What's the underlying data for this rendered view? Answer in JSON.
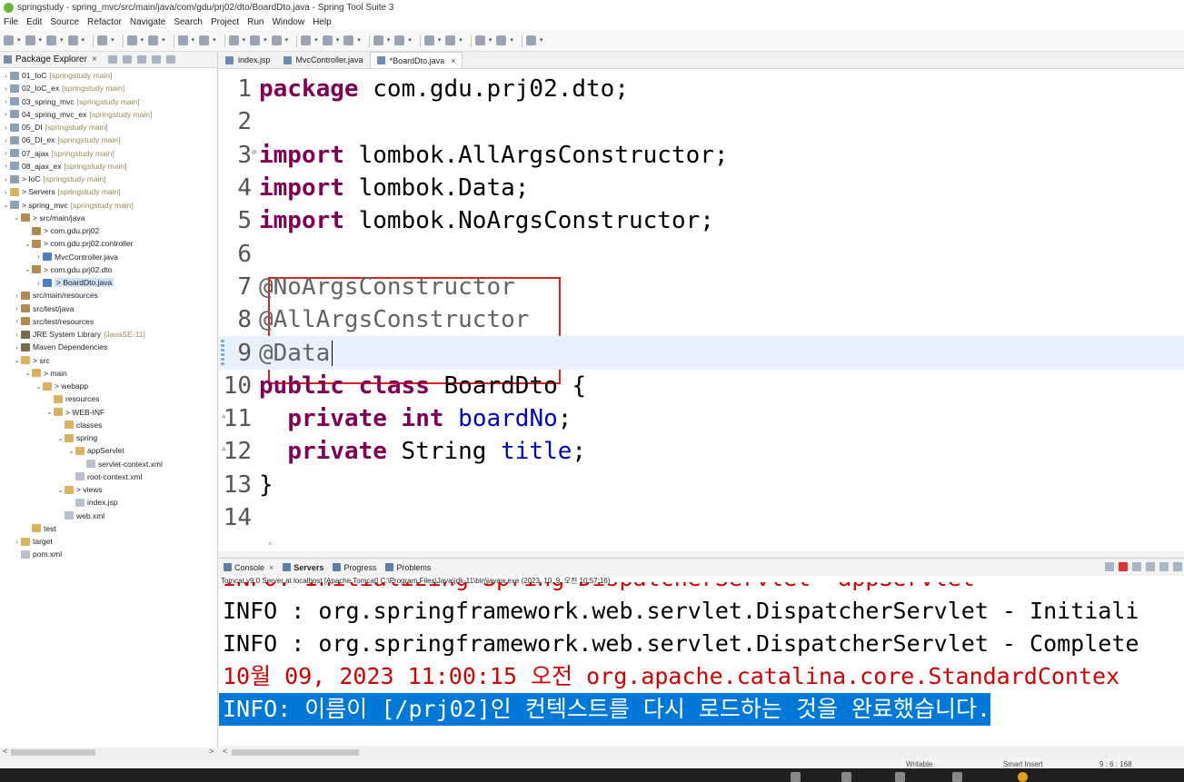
{
  "window": {
    "title": "springstudy - spring_mvc/src/main/java/com/gdu/prj02/dto/BoardDto.java - Spring Tool Suite 3"
  },
  "menu": [
    "File",
    "Edit",
    "Source",
    "Refactor",
    "Navigate",
    "Search",
    "Project",
    "Run",
    "Window",
    "Help"
  ],
  "explorer": {
    "title": "Package Explorer",
    "tree": [
      {
        "label": "01_IoC",
        "deco": "[springstudy main]",
        "twisty": ">",
        "icon": "project",
        "depth": 0
      },
      {
        "label": "02_IoC_ex",
        "deco": "[springstudy main]",
        "twisty": ">",
        "icon": "project",
        "depth": 0
      },
      {
        "label": "03_spring_mvc",
        "deco": "[springstudy main]",
        "twisty": ">",
        "icon": "project",
        "depth": 0
      },
      {
        "label": "04_spring_mvc_ex",
        "deco": "[springstudy main]",
        "twisty": ">",
        "icon": "project",
        "depth": 0
      },
      {
        "label": "05_DI",
        "deco": "[springstudy main]",
        "twisty": ">",
        "icon": "project",
        "depth": 0
      },
      {
        "label": "06_DI_ex",
        "deco": "[springstudy main]",
        "twisty": ">",
        "icon": "project",
        "depth": 0
      },
      {
        "label": "07_ajax",
        "deco": "[springstudy main]",
        "twisty": ">",
        "icon": "project",
        "depth": 0
      },
      {
        "label": "08_ajax_ex",
        "deco": "[springstudy main]",
        "twisty": ">",
        "icon": "project",
        "depth": 0
      },
      {
        "label": "> IoC",
        "deco": "[springstudy main]",
        "twisty": ">",
        "icon": "project",
        "depth": 0
      },
      {
        "label": "> Servers",
        "deco": "[springstudy main]",
        "twisty": ">",
        "icon": "folder",
        "depth": 0
      },
      {
        "label": "> spring_mvc",
        "deco": "[springstudy main]",
        "twisty": "v",
        "icon": "project",
        "depth": 0
      },
      {
        "label": "> src/main/java",
        "deco": "",
        "twisty": "v",
        "icon": "package",
        "depth": 1
      },
      {
        "label": "> com.gdu.prj02",
        "deco": "",
        "twisty": "",
        "icon": "package",
        "depth": 2
      },
      {
        "label": "> com.gdu.prj02.controller",
        "deco": "",
        "twisty": "v",
        "icon": "package",
        "depth": 2
      },
      {
        "label": "MvcController.java",
        "deco": "",
        "twisty": ">",
        "icon": "java",
        "depth": 3
      },
      {
        "label": "> com.gdu.prj02.dto",
        "deco": "",
        "twisty": "v",
        "icon": "package",
        "depth": 2
      },
      {
        "label": "> BoardDto.java",
        "deco": "",
        "twisty": ">",
        "icon": "java",
        "depth": 3,
        "selected": true
      },
      {
        "label": "src/main/resources",
        "deco": "",
        "twisty": ">",
        "icon": "package",
        "depth": 1
      },
      {
        "label": "src/test/java",
        "deco": "",
        "twisty": ">",
        "icon": "package",
        "depth": 1
      },
      {
        "label": "src/test/resources",
        "deco": "",
        "twisty": ">",
        "icon": "package",
        "depth": 1
      },
      {
        "label": "JRE System Library",
        "deco": "[JavaSE-11]",
        "twisty": ">",
        "icon": "lib",
        "depth": 1
      },
      {
        "label": "Maven Dependencies",
        "deco": "",
        "twisty": ">",
        "icon": "lib",
        "depth": 1
      },
      {
        "label": "> src",
        "deco": "",
        "twisty": "v",
        "icon": "folder",
        "depth": 1
      },
      {
        "label": "> main",
        "deco": "",
        "twisty": "v",
        "icon": "folder",
        "depth": 2
      },
      {
        "label": "> webapp",
        "deco": "",
        "twisty": "v",
        "icon": "folder",
        "depth": 3
      },
      {
        "label": "resources",
        "deco": "",
        "twisty": "",
        "icon": "folder",
        "depth": 4
      },
      {
        "label": "> WEB-INF",
        "deco": "",
        "twisty": "v",
        "icon": "folder",
        "depth": 4
      },
      {
        "label": "classes",
        "deco": "",
        "twisty": "",
        "icon": "folder",
        "depth": 5
      },
      {
        "label": "spring",
        "deco": "",
        "twisty": "v",
        "icon": "folder",
        "depth": 5
      },
      {
        "label": "appServlet",
        "deco": "",
        "twisty": "v",
        "icon": "folder",
        "depth": 6
      },
      {
        "label": "servlet-context.xml",
        "deco": "",
        "twisty": "",
        "icon": "file",
        "depth": 7
      },
      {
        "label": "root-context.xml",
        "deco": "",
        "twisty": "",
        "icon": "file",
        "depth": 6
      },
      {
        "label": "> views",
        "deco": "",
        "twisty": "v",
        "icon": "folder",
        "depth": 5
      },
      {
        "label": "index.jsp",
        "deco": "",
        "twisty": "",
        "icon": "file",
        "depth": 6
      },
      {
        "label": "web.xml",
        "deco": "",
        "twisty": "",
        "icon": "file",
        "depth": 5
      },
      {
        "label": "test",
        "deco": "",
        "twisty": "",
        "icon": "folder",
        "depth": 2
      },
      {
        "label": "target",
        "deco": "",
        "twisty": ">",
        "icon": "folder",
        "depth": 1
      },
      {
        "label": "pom.xml",
        "deco": "",
        "twisty": "",
        "icon": "file",
        "depth": 1
      }
    ]
  },
  "editor": {
    "tabs": [
      {
        "label": "index.jsp",
        "active": false
      },
      {
        "label": "MvcController.java",
        "active": false
      },
      {
        "label": "*BoardDto.java",
        "active": true
      }
    ],
    "lines": [
      {
        "num": "1",
        "tokens": [
          {
            "t": "package",
            "c": "kw"
          },
          {
            "t": " com.gdu.prj02.dto;",
            "c": ""
          }
        ]
      },
      {
        "num": "2",
        "tokens": []
      },
      {
        "num": "3",
        "marker": "fold",
        "tokens": [
          {
            "t": "import",
            "c": "kw"
          },
          {
            "t": " lombok.AllArgsConstructor;",
            "c": ""
          }
        ]
      },
      {
        "num": "4",
        "tokens": [
          {
            "t": "import",
            "c": "kw"
          },
          {
            "t": " lombok.Data;",
            "c": ""
          }
        ]
      },
      {
        "num": "5",
        "tokens": [
          {
            "t": "import",
            "c": "kw"
          },
          {
            "t": " lombok.NoArgsConstructor;",
            "c": ""
          }
        ]
      },
      {
        "num": "6",
        "tokens": []
      },
      {
        "num": "7",
        "tokens": [
          {
            "t": "@NoArgsConstructor",
            "c": "anno"
          }
        ]
      },
      {
        "num": "8",
        "tokens": [
          {
            "t": "@AllArgsConstructor",
            "c": "anno"
          }
        ]
      },
      {
        "num": "9",
        "current": true,
        "caret": true,
        "tokens": [
          {
            "t": "@Data",
            "c": "anno"
          }
        ]
      },
      {
        "num": "10",
        "tokens": [
          {
            "t": "public",
            "c": "kw"
          },
          {
            "t": " ",
            "c": ""
          },
          {
            "t": "class",
            "c": "kw"
          },
          {
            "t": " BoardDto {",
            "c": ""
          }
        ]
      },
      {
        "num": "11",
        "marker": "triangle",
        "tokens": [
          {
            "t": "  ",
            "c": ""
          },
          {
            "t": "private",
            "c": "kw"
          },
          {
            "t": " ",
            "c": ""
          },
          {
            "t": "int",
            "c": "kw"
          },
          {
            "t": " ",
            "c": ""
          },
          {
            "t": "boardNo",
            "c": "field"
          },
          {
            "t": ";",
            "c": ""
          }
        ]
      },
      {
        "num": "12",
        "marker": "triangle",
        "tokens": [
          {
            "t": "  ",
            "c": ""
          },
          {
            "t": "private",
            "c": "kw"
          },
          {
            "t": " String ",
            "c": ""
          },
          {
            "t": "title",
            "c": "field"
          },
          {
            "t": ";",
            "c": ""
          }
        ]
      },
      {
        "num": "13",
        "tokens": [
          {
            "t": "}",
            "c": ""
          }
        ]
      },
      {
        "num": "14",
        "tokens": []
      }
    ]
  },
  "console": {
    "tabs": [
      {
        "label": "Console",
        "closable": true,
        "bold": false
      },
      {
        "label": "Servers",
        "closable": false,
        "bold": true
      },
      {
        "label": "Progress",
        "closable": false,
        "bold": false
      },
      {
        "label": "Problems",
        "closable": false,
        "bold": false
      }
    ],
    "status": "Tomcat v9.0 Server at localhost [Apache Tomcat] C:\\Program Files\\Java\\jdk-11\\bin\\javaw.exe  (2023. 10. 9. 오전 10:57:16)",
    "lines": [
      {
        "text": "INFO: Initializing Spring DispatcherServlet 'appServlet'",
        "kind": "error"
      },
      {
        "text": "INFO : org.springframework.web.servlet.DispatcherServlet - Initiali",
        "kind": "info"
      },
      {
        "text": "INFO : org.springframework.web.servlet.DispatcherServlet - Complete",
        "kind": "info"
      },
      {
        "text": "10월 09, 2023 11:00:15 오전 org.apache.catalina.core.StandardContex",
        "kind": "error"
      },
      {
        "text": "INFO: 이름이 [/prj02]인 컨텍스트를 다시 로드하는 것을 완료했습니다.",
        "kind": "highlight"
      }
    ]
  },
  "statusbar": {
    "writable": "Writable",
    "insert_mode": "Smart Insert",
    "position": "9 : 6 : 168"
  },
  "colors": {
    "keyword": "#7f0055",
    "annotation": "#646464",
    "field": "#0000c0",
    "error_text": "#d00000",
    "highlight_bg": "#0078d7",
    "annotation_box": "#e0201a"
  }
}
